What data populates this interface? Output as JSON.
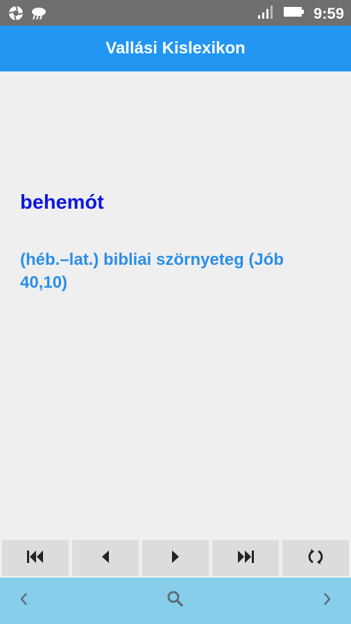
{
  "status_bar": {
    "time": "9:59",
    "left_icons": [
      "aperture-icon",
      "cloud-icon"
    ],
    "right_icons": [
      "signal-icon",
      "battery-icon"
    ]
  },
  "app_bar": {
    "title": "Vallási Kislexikon"
  },
  "entry": {
    "term": "behemót",
    "definition": "(héb.–lat.) bibliai szörnyeteg (Jób 40,10)"
  },
  "nav_buttons": [
    "first-icon",
    "previous-icon",
    "next-icon",
    "last-icon",
    "random-icon"
  ],
  "bottom_bar": [
    "back-icon",
    "search-icon",
    "forward-icon"
  ],
  "colors": {
    "status_bar": "#6f6f6f",
    "app_bar": "#2196f3",
    "term": "#0d17e0",
    "definition": "#2a8ee8",
    "nav_button": "#dcdcdc",
    "bottom_bar": "#87ceeb",
    "background": "#efefef"
  }
}
